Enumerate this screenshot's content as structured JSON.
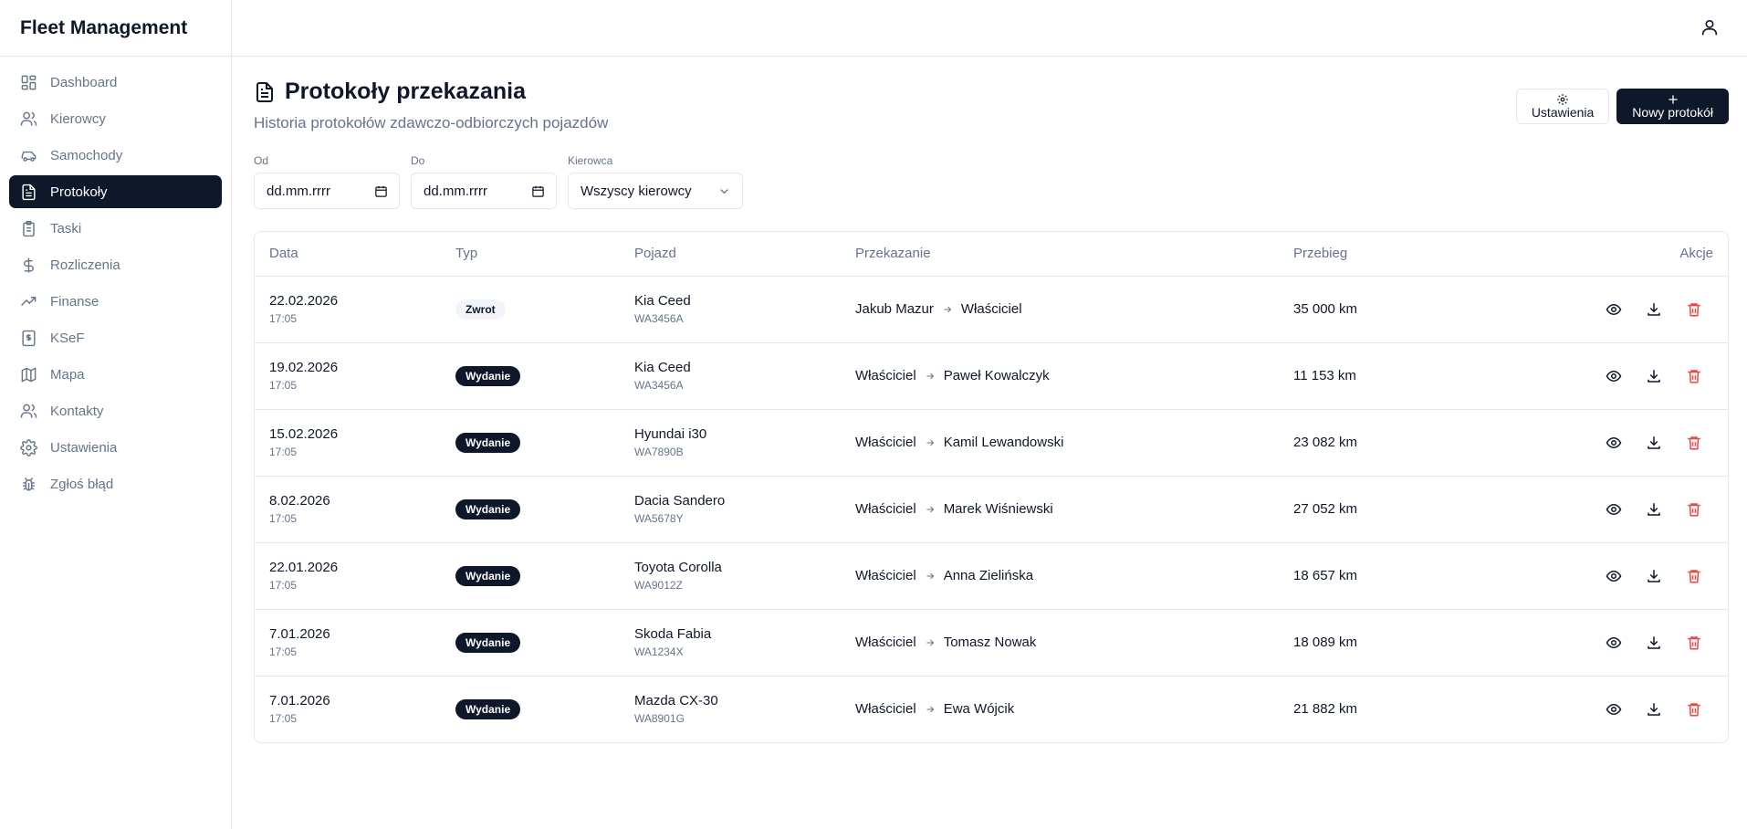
{
  "app": {
    "title": "Fleet Management"
  },
  "sidebar": {
    "items": [
      {
        "label": "Dashboard",
        "icon": "dashboard-icon"
      },
      {
        "label": "Kierowcy",
        "icon": "users-icon"
      },
      {
        "label": "Samochody",
        "icon": "car-icon"
      },
      {
        "label": "Protokoły",
        "icon": "document-icon",
        "active": true
      },
      {
        "label": "Taski",
        "icon": "clipboard-icon"
      },
      {
        "label": "Rozliczenia",
        "icon": "dollar-icon"
      },
      {
        "label": "Finanse",
        "icon": "trend-icon"
      },
      {
        "label": "KSeF",
        "icon": "receipt-icon"
      },
      {
        "label": "Mapa",
        "icon": "map-icon"
      },
      {
        "label": "Kontakty",
        "icon": "contacts-icon"
      },
      {
        "label": "Ustawienia",
        "icon": "gear-icon"
      },
      {
        "label": "Zgłoś błąd",
        "icon": "bug-icon"
      }
    ]
  },
  "page": {
    "title": "Protokoły przekazania",
    "subtitle": "Historia protokołów zdawczo-odbiorczych pojazdów",
    "settings_label": "Ustawienia",
    "new_label": "Nowy protokół"
  },
  "filters": {
    "from_label": "Od",
    "from_value": "dd.mm.rrrr",
    "to_label": "Do",
    "to_value": "dd.mm.rrrr",
    "driver_label": "Kierowca",
    "driver_value": "Wszyscy kierowcy"
  },
  "table": {
    "headers": {
      "date": "Data",
      "type": "Typ",
      "vehicle": "Pojazd",
      "transfer": "Przekazanie",
      "mileage": "Przebieg",
      "actions": "Akcje"
    },
    "rows": [
      {
        "date": "22.02.2026",
        "time": "17:05",
        "type": "Zwrot",
        "vehicle": "Kia Ceed",
        "plate": "WA3456A",
        "from": "Jakub Mazur",
        "to": "Właściciel",
        "mileage": "35 000 km"
      },
      {
        "date": "19.02.2026",
        "time": "17:05",
        "type": "Wydanie",
        "vehicle": "Kia Ceed",
        "plate": "WA3456A",
        "from": "Właściciel",
        "to": "Paweł Kowalczyk",
        "mileage": "11 153 km"
      },
      {
        "date": "15.02.2026",
        "time": "17:05",
        "type": "Wydanie",
        "vehicle": "Hyundai i30",
        "plate": "WA7890B",
        "from": "Właściciel",
        "to": "Kamil Lewandowski",
        "mileage": "23 082 km"
      },
      {
        "date": "8.02.2026",
        "time": "17:05",
        "type": "Wydanie",
        "vehicle": "Dacia Sandero",
        "plate": "WA5678Y",
        "from": "Właściciel",
        "to": "Marek Wiśniewski",
        "mileage": "27 052 km"
      },
      {
        "date": "22.01.2026",
        "time": "17:05",
        "type": "Wydanie",
        "vehicle": "Toyota Corolla",
        "plate": "WA9012Z",
        "from": "Właściciel",
        "to": "Anna Zielińska",
        "mileage": "18 657 km"
      },
      {
        "date": "7.01.2026",
        "time": "17:05",
        "type": "Wydanie",
        "vehicle": "Skoda Fabia",
        "plate": "WA1234X",
        "from": "Właściciel",
        "to": "Tomasz Nowak",
        "mileage": "18 089 km"
      },
      {
        "date": "7.01.2026",
        "time": "17:05",
        "type": "Wydanie",
        "vehicle": "Mazda CX-30",
        "plate": "WA8901G",
        "from": "Właściciel",
        "to": "Ewa Wójcik",
        "mileage": "21 882 km"
      }
    ]
  },
  "colors": {
    "dark": "#0f172a",
    "muted": "#64748b",
    "border": "#e5e7eb",
    "danger": "#ef4444"
  }
}
